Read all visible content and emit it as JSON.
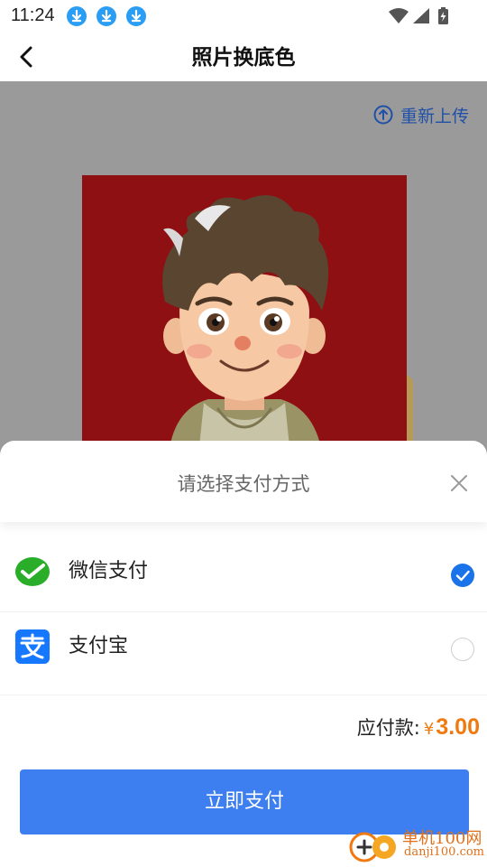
{
  "status_bar": {
    "time": "11:24",
    "download_icon_color": "#2a9df4"
  },
  "header": {
    "title": "照片换底色"
  },
  "preview": {
    "reupload_label": "重新上传",
    "background_color": "#8e1012"
  },
  "sheet": {
    "title": "请选择支付方式",
    "methods": [
      {
        "label": "微信支付",
        "icon": "wechat-pay-icon",
        "selected": true
      },
      {
        "label": "支付宝",
        "icon": "alipay-icon",
        "selected": false
      }
    ],
    "amount_label": "应付款:",
    "currency_symbol": "¥",
    "amount": "3.00",
    "pay_button_label": "立即支付"
  },
  "watermark": {
    "line1": "单机100网",
    "line2": "danji100.com"
  },
  "colors": {
    "accent": "#3d7ef0",
    "price": "#f07a10",
    "selected_radio": "#1a73e8"
  }
}
